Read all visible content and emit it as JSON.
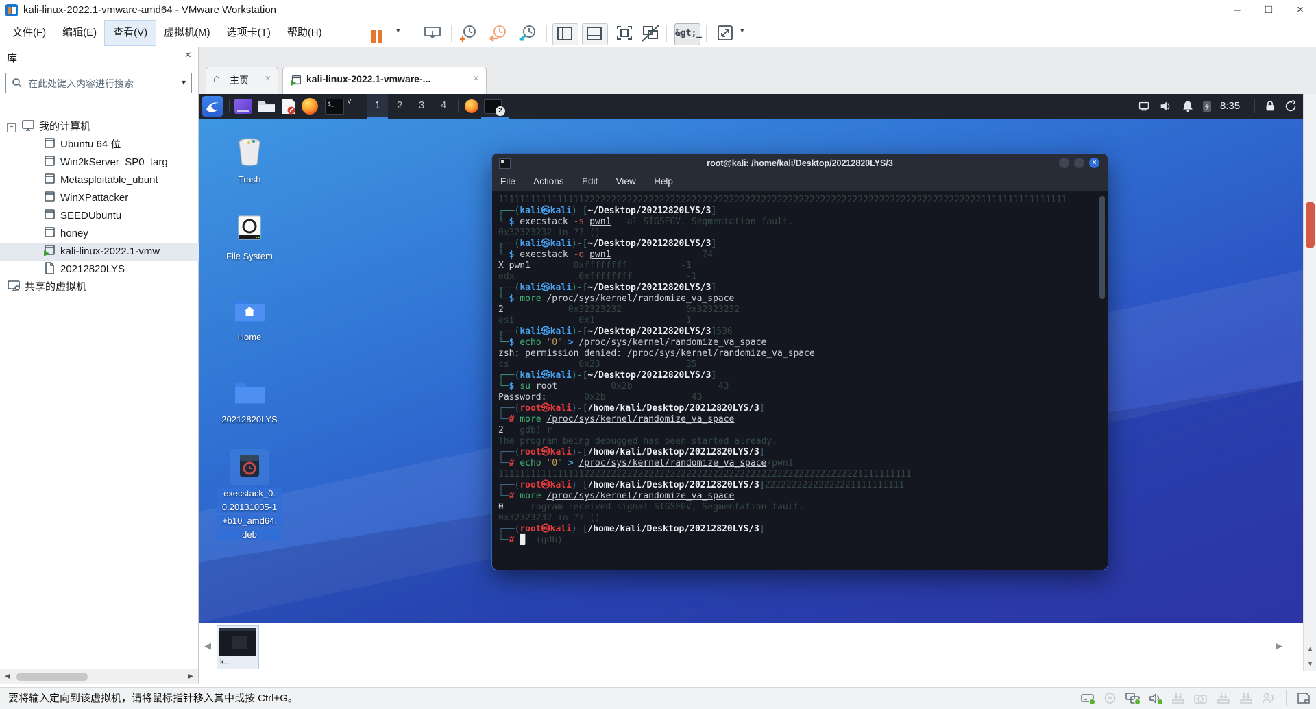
{
  "glyphs": {
    "minimize": "–",
    "maximize": "□",
    "close": "×",
    "dropdown": "▾",
    "chevron_down": "˅",
    "left_arrow": "◀",
    "right_arrow": "▶",
    "up_arrow": "▲",
    "down_arrow": "▼",
    "home": "⌂",
    "expander_collapse": "−",
    "console": "&gt;_"
  },
  "window": {
    "title": "kali-linux-2022.1-vmware-amd64 - VMware Workstation"
  },
  "menubar": {
    "highlighted": 2,
    "items": [
      "文件(F)",
      "编辑(E)",
      "查看(V)",
      "虚拟机(M)",
      "选项卡(T)",
      "帮助(H)"
    ]
  },
  "sidebar": {
    "title": "库",
    "search_placeholder": "在此处键入内容进行搜索",
    "tree": [
      {
        "label": "我的计算机",
        "type": "computer",
        "depth": 0,
        "expander": true
      },
      {
        "label": "Ubuntu 64 位",
        "type": "vm",
        "depth": 1
      },
      {
        "label": "Win2kServer_SP0_targ",
        "type": "vm",
        "depth": 1
      },
      {
        "label": "Metasploitable_ubunt",
        "type": "vm",
        "depth": 1
      },
      {
        "label": "WinXPattacker",
        "type": "vm",
        "depth": 1
      },
      {
        "label": "SEEDUbuntu",
        "type": "vm",
        "depth": 1
      },
      {
        "label": "honey",
        "type": "vm",
        "depth": 1
      },
      {
        "label": "kali-linux-2022.1-vmw",
        "type": "vm-running",
        "depth": 1,
        "selected": true
      },
      {
        "label": "20212820LYS",
        "type": "doc",
        "depth": 1
      },
      {
        "label": "共享的虚拟机",
        "type": "shared",
        "depth": 0
      }
    ]
  },
  "tabs": {
    "home": {
      "label": "主页"
    },
    "vm": {
      "label": "kali-linux-2022.1-vmware-..."
    }
  },
  "guest": {
    "clock": "8:35",
    "workspaces": [
      "1",
      "2",
      "3",
      "4"
    ],
    "active_workspace": 0,
    "terminal_badge": "2",
    "desktop_icons": [
      {
        "type": "trash",
        "label": "Trash"
      },
      {
        "type": "filesystem",
        "label": "File System"
      },
      {
        "type": "home",
        "label": "Home"
      },
      {
        "type": "folder",
        "label": "20212820LYS"
      },
      {
        "type": "deb",
        "selected": true,
        "label_lines": [
          "execstack_0.",
          "0.20131005-1",
          "+b10_amd64.",
          "deb"
        ]
      }
    ]
  },
  "terminal": {
    "title": "root@kali: /home/kali/Desktop/20212820LYS/3",
    "menu": [
      "File",
      "Actions",
      "Edit",
      "View",
      "Help"
    ],
    "lines": [
      [
        {
          "t": "1111111111111111222222222222222222222222222222222222222222222222222222222222222222222222221111111111111111",
          "c": "gh"
        }
      ],
      [
        {
          "t": "┌──(",
          "c": "f"
        },
        {
          "t": "kali㉿kali",
          "c": "u"
        },
        {
          "t": ")-[",
          "c": "f"
        },
        {
          "t": "~/Desktop/20212820LYS/3",
          "c": "p"
        },
        {
          "t": "]",
          "c": "f"
        }
      ],
      [
        {
          "t": "└─",
          "c": "f"
        },
        {
          "t": "$",
          "c": "d"
        },
        {
          "t": " execstack ",
          "c": "w"
        },
        {
          "t": "-s",
          "c": "o"
        },
        {
          "t": " ",
          "c": "w"
        },
        {
          "t": "pwn1",
          "c": "un"
        },
        {
          "t": "   al SIGSEGV, Segmentation fault.",
          "c": "gh"
        }
      ],
      [
        {
          "t": "0x32323232 in ?? ()",
          "c": "gh"
        }
      ],
      [
        {
          "t": "┌──(",
          "c": "f"
        },
        {
          "t": "kali㉿kali",
          "c": "u"
        },
        {
          "t": ")-[",
          "c": "f"
        },
        {
          "t": "~/Desktop/20212820LYS/3",
          "c": "p"
        },
        {
          "t": "]",
          "c": "f"
        }
      ],
      [
        {
          "t": "└─",
          "c": "f"
        },
        {
          "t": "$",
          "c": "d"
        },
        {
          "t": " execstack ",
          "c": "w"
        },
        {
          "t": "-q",
          "c": "o"
        },
        {
          "t": " ",
          "c": "w"
        },
        {
          "t": "pwn1",
          "c": "un"
        },
        {
          "t": "                 74",
          "c": "gh"
        }
      ],
      [
        {
          "t": "X pwn1",
          "c": "w"
        },
        {
          "t": "        0xffffffff          -1",
          "c": "gh"
        }
      ],
      [
        {
          "t": "edx            0xffffffff          -1",
          "c": "gh"
        }
      ],
      [
        {
          "t": "┌──(",
          "c": "f"
        },
        {
          "t": "kali㉿kali",
          "c": "u"
        },
        {
          "t": ")-[",
          "c": "f"
        },
        {
          "t": "~/Desktop/20212820LYS/3",
          "c": "p"
        },
        {
          "t": "]",
          "c": "f"
        }
      ],
      [
        {
          "t": "└─",
          "c": "f"
        },
        {
          "t": "$",
          "c": "d"
        },
        {
          "t": " ",
          "c": "w"
        },
        {
          "t": "more",
          "c": "g"
        },
        {
          "t": " ",
          "c": "w"
        },
        {
          "t": "/proc/sys/kernel/randomize_va_space",
          "c": "un"
        }
      ],
      [
        {
          "t": "2",
          "c": "w"
        },
        {
          "t": "            0x32323232            0x32323232",
          "c": "gh"
        }
      ],
      [
        {
          "t": "esi            0x1                 1",
          "c": "gh"
        }
      ],
      [
        {
          "t": "┌──(",
          "c": "f"
        },
        {
          "t": "kali㉿kali",
          "c": "u"
        },
        {
          "t": ")-[",
          "c": "f"
        },
        {
          "t": "~/Desktop/20212820LYS/3",
          "c": "p"
        },
        {
          "t": "]",
          "c": "f"
        },
        {
          "t": "536",
          "c": "gh"
        }
      ],
      [
        {
          "t": "└─",
          "c": "f"
        },
        {
          "t": "$",
          "c": "d"
        },
        {
          "t": " ",
          "c": "w"
        },
        {
          "t": "echo",
          "c": "g"
        },
        {
          "t": " ",
          "c": "w"
        },
        {
          "t": "\"0\"",
          "c": "s"
        },
        {
          "t": " ",
          "c": "w"
        },
        {
          "t": ">",
          "c": "re"
        },
        {
          "t": " ",
          "c": "w"
        },
        {
          "t": "/proc/sys/kernel/randomize_va_space",
          "c": "un"
        }
      ],
      [
        {
          "t": "zsh: permission denied: /proc/sys/kernel/randomize_va_space",
          "c": "w"
        }
      ],
      [
        {
          "t": "cs             0x23                35",
          "c": "gh"
        }
      ],
      [
        {
          "t": "┌──(",
          "c": "f"
        },
        {
          "t": "kali㉿kali",
          "c": "u"
        },
        {
          "t": ")-[",
          "c": "f"
        },
        {
          "t": "~/Desktop/20212820LYS/3",
          "c": "p"
        },
        {
          "t": "]",
          "c": "f"
        }
      ],
      [
        {
          "t": "└─",
          "c": "f"
        },
        {
          "t": "$",
          "c": "d"
        },
        {
          "t": " ",
          "c": "w"
        },
        {
          "t": "su",
          "c": "g"
        },
        {
          "t": " root",
          "c": "w"
        },
        {
          "t": "          0x2b                43",
          "c": "gh"
        }
      ],
      [
        {
          "t": "Password:",
          "c": "w"
        },
        {
          "t": "       0x2b                43",
          "c": "gh"
        }
      ],
      [
        {
          "t": "┌──(",
          "c": "fr"
        },
        {
          "t": "root㉿kali",
          "c": "r"
        },
        {
          "t": ")-[",
          "c": "fr"
        },
        {
          "t": "/home/kali/Desktop/20212820LYS/3",
          "c": "p"
        },
        {
          "t": "]",
          "c": "fr"
        }
      ],
      [
        {
          "t": "└─",
          "c": "fr"
        },
        {
          "t": "#",
          "c": "h"
        },
        {
          "t": " ",
          "c": "w"
        },
        {
          "t": "more",
          "c": "g"
        },
        {
          "t": " ",
          "c": "w"
        },
        {
          "t": "/proc/sys/kernel/randomize_va_space",
          "c": "un"
        }
      ],
      [
        {
          "t": "2",
          "c": "w"
        },
        {
          "t": "   gdb) r",
          "c": "gh"
        }
      ],
      [
        {
          "t": "The program being debugged has been started already.",
          "c": "gh"
        }
      ],
      [
        {
          "t": "┌──(",
          "c": "fr"
        },
        {
          "t": "root㉿kali",
          "c": "r"
        },
        {
          "t": ")-[",
          "c": "fr"
        },
        {
          "t": "/home/kali/Desktop/20212820LYS/3",
          "c": "p"
        },
        {
          "t": "]",
          "c": "fr"
        }
      ],
      [
        {
          "t": "└─",
          "c": "fr"
        },
        {
          "t": "#",
          "c": "h"
        },
        {
          "t": " ",
          "c": "w"
        },
        {
          "t": "echo",
          "c": "g"
        },
        {
          "t": " ",
          "c": "w"
        },
        {
          "t": "\"0\"",
          "c": "s"
        },
        {
          "t": " ",
          "c": "w"
        },
        {
          "t": ">",
          "c": "re"
        },
        {
          "t": " ",
          "c": "w"
        },
        {
          "t": "/proc/sys/kernel/randomize_va_space",
          "c": "un"
        },
        {
          "t": "/pwn1",
          "c": "gh"
        }
      ],
      [
        {
          "t": "11111111111111112222222222222222222222222222222222222222222222222221111111111",
          "c": "gh"
        }
      ],
      [
        {
          "t": "┌──(",
          "c": "fr"
        },
        {
          "t": "root㉿kali",
          "c": "r"
        },
        {
          "t": ")-[",
          "c": "fr"
        },
        {
          "t": "/home/kali/Desktop/20212820LYS/3",
          "c": "p"
        },
        {
          "t": "]",
          "c": "fr"
        },
        {
          "t": "22222222222222221111111111",
          "c": "gh"
        }
      ],
      [
        {
          "t": "└─",
          "c": "fr"
        },
        {
          "t": "#",
          "c": "h"
        },
        {
          "t": " ",
          "c": "w"
        },
        {
          "t": "more",
          "c": "g"
        },
        {
          "t": " ",
          "c": "w"
        },
        {
          "t": "/proc/sys/kernel/randomize_va_space",
          "c": "un"
        }
      ],
      [
        {
          "t": "0",
          "c": "w"
        },
        {
          "t": "     rogram received signal SIGSEGV, Segmentation fault.",
          "c": "gh"
        }
      ],
      [
        {
          "t": "0x32323232 in ?? ()",
          "c": "gh"
        }
      ],
      [
        {
          "t": "┌──(",
          "c": "fr"
        },
        {
          "t": "root㉿kali",
          "c": "r"
        },
        {
          "t": ")-[",
          "c": "fr"
        },
        {
          "t": "/home/kali/Desktop/20212820LYS/3",
          "c": "p"
        },
        {
          "t": "]",
          "c": "fr"
        }
      ],
      [
        {
          "t": "└─",
          "c": "fr"
        },
        {
          "t": "#",
          "c": "h"
        },
        {
          "t": " ",
          "c": "w"
        },
        {
          "t": "█",
          "c": "cur"
        },
        {
          "t": "  (gdb)",
          "c": "gh"
        }
      ]
    ]
  },
  "thumbbar": {
    "label": "k..."
  },
  "statusbar": {
    "message": "要将输入定向到该虚拟机，请将鼠标指针移入其中或按 Ctrl+G。",
    "icons": [
      {
        "name": "hard-disk",
        "active": true,
        "dot": true
      },
      {
        "name": "cd-rom",
        "active": false
      },
      {
        "name": "network-adapter",
        "active": true,
        "dot": true
      },
      {
        "name": "sound",
        "active": true,
        "dot": true
      },
      {
        "name": "usb-device",
        "active": false
      },
      {
        "name": "screenshot-camera",
        "active": false
      },
      {
        "name": "usb-device-2",
        "active": false
      },
      {
        "name": "usb-device-3",
        "active": false
      },
      {
        "name": "voice",
        "active": false
      },
      {
        "name": "message-log",
        "active": true,
        "separate": true
      }
    ]
  },
  "colors": {
    "accent_orange": "#e8762c",
    "accent_blue": "#2e6fd8",
    "kali_underline": "#3a86e0",
    "scroll_thumb": "#d55a45",
    "status_green": "#58b335"
  }
}
